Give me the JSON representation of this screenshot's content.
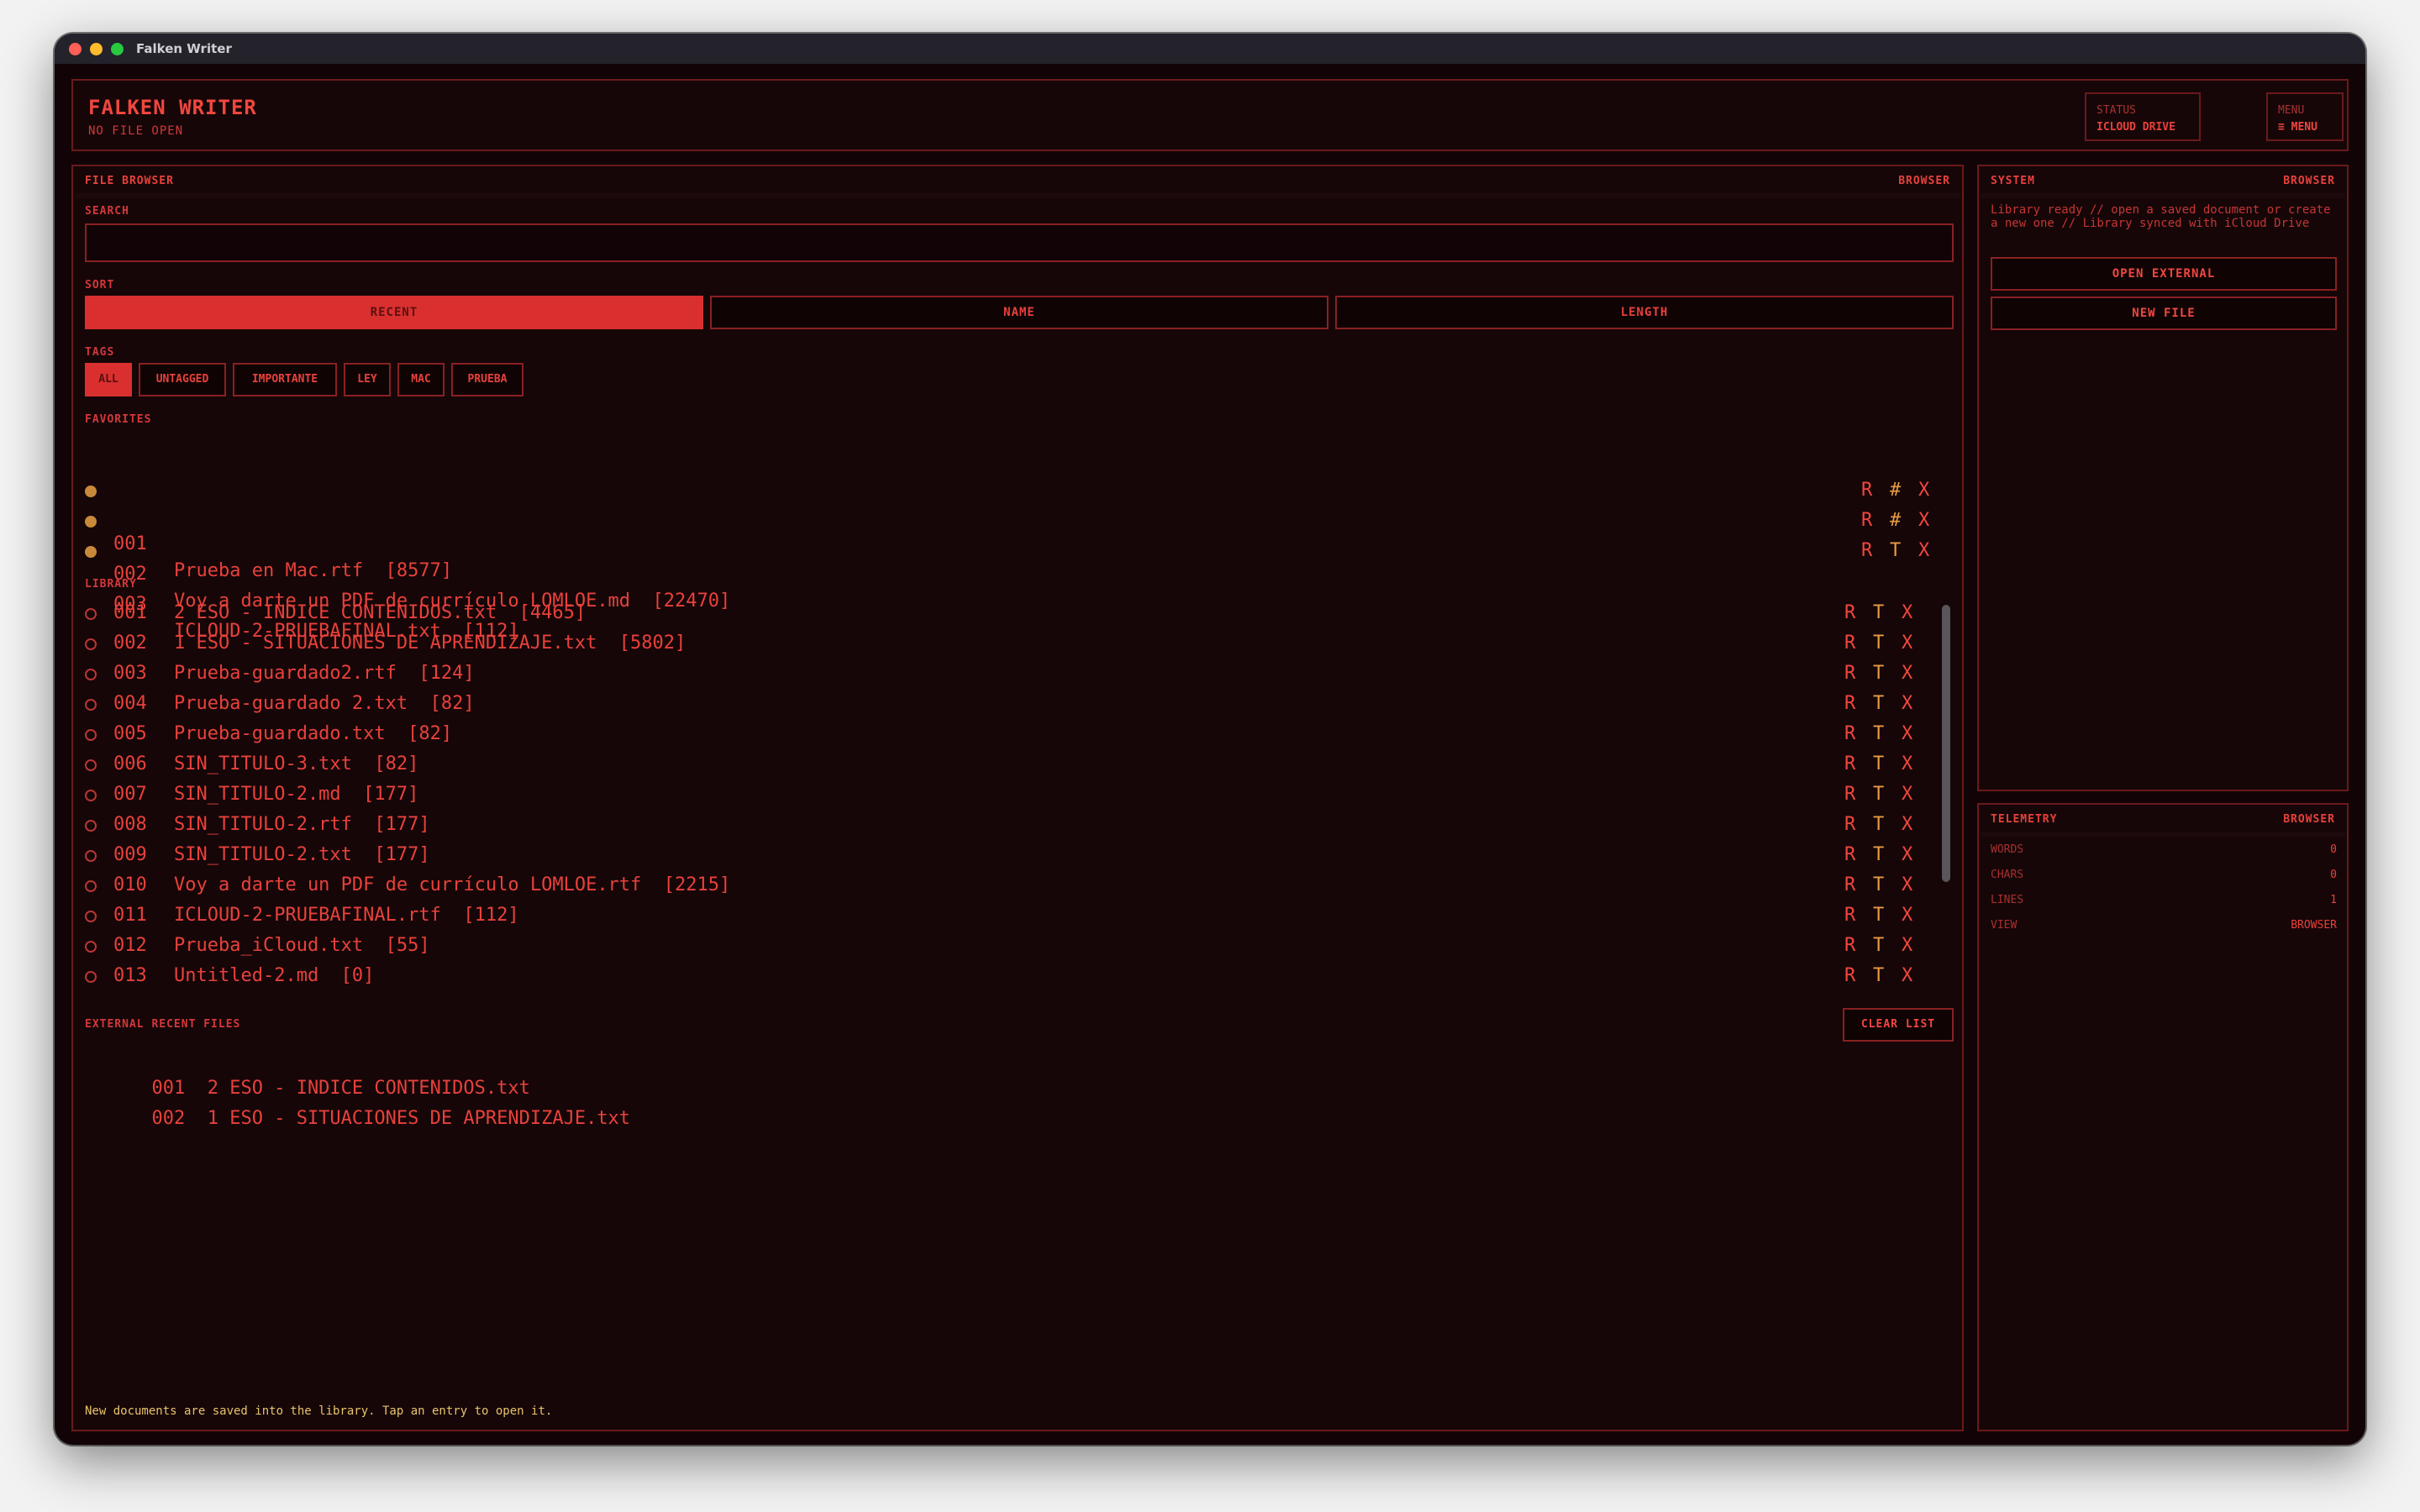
{
  "window": {
    "title": "Falken Writer"
  },
  "header": {
    "title": "FALKEN WRITER",
    "subtitle": "NO FILE OPEN",
    "status_label": "STATUS",
    "status_value": "ICLOUD DRIVE",
    "menu_label": "MENU",
    "menu_value": "≡ MENU"
  },
  "browser": {
    "title": "FILE BROWSER",
    "tag": "BROWSER",
    "search_label": "SEARCH",
    "search_value": "",
    "sort_label": "SORT",
    "sort": [
      "RECENT",
      "NAME",
      "LENGTH"
    ],
    "tags_label": "TAGS",
    "tags": [
      "ALL",
      "UNTAGGED",
      "IMPORTANTE",
      "LEY",
      "MAC",
      "PRUEBA"
    ],
    "favorites_label": "FAVORITES",
    "favorites": [
      {
        "num": "001",
        "name": "Prueba en Mac.rtf  [8577]",
        "a1": "R",
        "a2": "#",
        "a3": "X"
      },
      {
        "num": "002",
        "name": "Voy a darte un PDF de currículo LOMLOE.md  [22470]",
        "a1": "R",
        "a2": "#",
        "a3": "X"
      },
      {
        "num": "003",
        "name": "ICLOUD-2-PRUEBAFINAL.txt  [112]",
        "a1": "R",
        "a2": "T",
        "a3": "X"
      }
    ],
    "library_label": "LIBRARY",
    "library": [
      {
        "num": "001",
        "name": "2 ESO - INDICE CONTENIDOS.txt  [4465]",
        "a1": "R",
        "a2": "T",
        "a3": "X"
      },
      {
        "num": "002",
        "name": "1 ESO - SITUACIONES DE APRENDIZAJE.txt  [5802]",
        "a1": "R",
        "a2": "T",
        "a3": "X"
      },
      {
        "num": "003",
        "name": "Prueba-guardado2.rtf  [124]",
        "a1": "R",
        "a2": "T",
        "a3": "X"
      },
      {
        "num": "004",
        "name": "Prueba-guardado 2.txt  [82]",
        "a1": "R",
        "a2": "T",
        "a3": "X"
      },
      {
        "num": "005",
        "name": "Prueba-guardado.txt  [82]",
        "a1": "R",
        "a2": "T",
        "a3": "X"
      },
      {
        "num": "006",
        "name": "SIN_TITULO-3.txt  [82]",
        "a1": "R",
        "a2": "T",
        "a3": "X"
      },
      {
        "num": "007",
        "name": "SIN_TITULO-2.md  [177]",
        "a1": "R",
        "a2": "T",
        "a3": "X"
      },
      {
        "num": "008",
        "name": "SIN_TITULO-2.rtf  [177]",
        "a1": "R",
        "a2": "T",
        "a3": "X"
      },
      {
        "num": "009",
        "name": "SIN_TITULO-2.txt  [177]",
        "a1": "R",
        "a2": "T",
        "a3": "X"
      },
      {
        "num": "010",
        "name": "Voy a darte un PDF de currículo LOMLOE.rtf  [2215]",
        "a1": "R",
        "a2": "T",
        "a3": "X"
      },
      {
        "num": "011",
        "name": "ICLOUD-2-PRUEBAFINAL.rtf  [112]",
        "a1": "R",
        "a2": "T",
        "a3": "X"
      },
      {
        "num": "012",
        "name": "Prueba_iCloud.txt  [55]",
        "a1": "R",
        "a2": "T",
        "a3": "X"
      },
      {
        "num": "013",
        "name": "Untitled-2.md  [0]",
        "a1": "R",
        "a2": "T",
        "a3": "X"
      }
    ],
    "external_label": "EXTERNAL RECENT FILES",
    "clear_label": "CLEAR LIST",
    "external": [
      {
        "num": "001",
        "name": "2 ESO - INDICE CONTENIDOS.txt"
      },
      {
        "num": "002",
        "name": "1 ESO - SITUACIONES DE APRENDIZAJE.txt"
      }
    ],
    "footer": "New documents are saved into the library. Tap an entry to open it."
  },
  "system": {
    "title": "SYSTEM",
    "tag": "BROWSER",
    "message": "Library ready // open a saved document or create a new one // Library synced with iCloud Drive",
    "open_external": "OPEN EXTERNAL",
    "new_file": "NEW FILE"
  },
  "telemetry": {
    "title": "TELEMETRY",
    "tag": "BROWSER",
    "rows": [
      {
        "k": "WORDS",
        "v": "0"
      },
      {
        "k": "CHARS",
        "v": "0"
      },
      {
        "k": "LINES",
        "v": "1"
      },
      {
        "k": "VIEW",
        "v": "BROWSER"
      }
    ]
  },
  "colors": {
    "accent": "#e8413b",
    "background": "#120406",
    "favorite_dot": "#c88a3a",
    "tag_action": "#ea9b43"
  }
}
